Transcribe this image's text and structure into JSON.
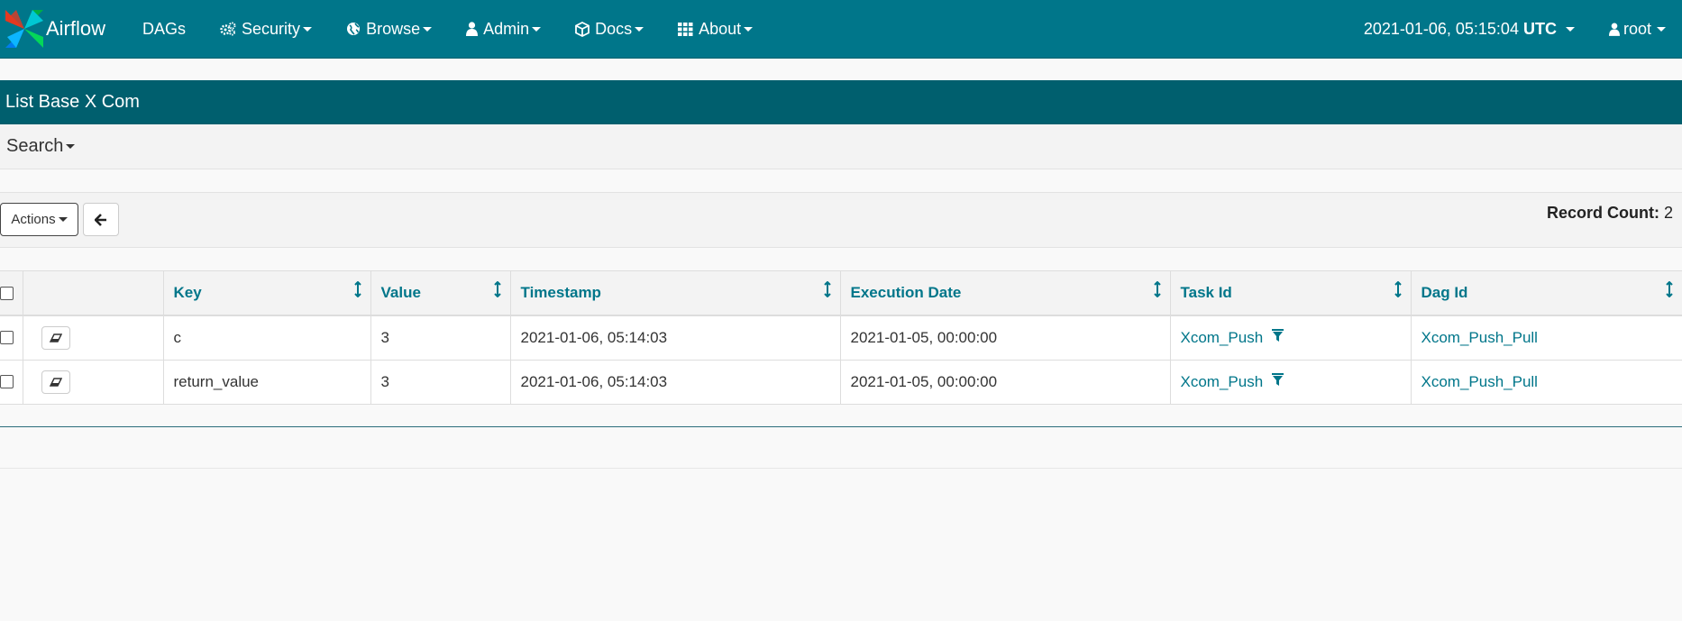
{
  "nav": {
    "brand": "Airflow",
    "items": [
      {
        "label": "DAGs",
        "icon": "",
        "caret": false
      },
      {
        "label": "Security",
        "icon": "cogs-icon",
        "caret": true
      },
      {
        "label": "Browse",
        "icon": "globe-icon",
        "caret": true
      },
      {
        "label": "Admin",
        "icon": "user-icon",
        "caret": true
      },
      {
        "label": "Docs",
        "icon": "cube-icon",
        "caret": true
      },
      {
        "label": "About",
        "icon": "grid-icon",
        "caret": true
      }
    ],
    "clock_time": "2021-01-06, 05:15:04",
    "clock_tz": "UTC",
    "user": "root"
  },
  "panel": {
    "title": "List Base X Com",
    "search_label": "Search"
  },
  "toolbar": {
    "actions_label": "Actions",
    "record_count_label": "Record Count:",
    "record_count": "2"
  },
  "table": {
    "columns": [
      "Key",
      "Value",
      "Timestamp",
      "Execution Date",
      "Task Id",
      "Dag Id"
    ],
    "rows": [
      {
        "key": "c",
        "value": "3",
        "timestamp": "2021-01-06, 05:14:03",
        "execution_date": "2021-01-05, 00:00:00",
        "task_id": "Xcom_Push",
        "dag_id": "Xcom_Push_Pull"
      },
      {
        "key": "return_value",
        "value": "3",
        "timestamp": "2021-01-06, 05:14:03",
        "execution_date": "2021-01-05, 00:00:00",
        "task_id": "Xcom_Push",
        "dag_id": "Xcom_Push_Pull"
      }
    ]
  },
  "colors": {
    "navbar": "#00768a",
    "panel_header": "#005f6e",
    "link": "#00768a"
  }
}
